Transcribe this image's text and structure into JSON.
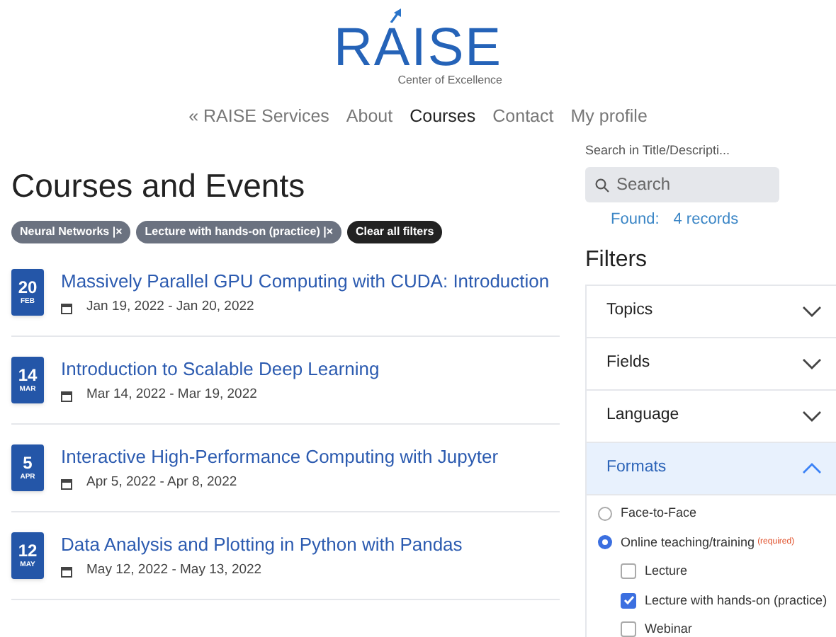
{
  "logo": {
    "name": "RAISE",
    "tagline": "Center of Excellence"
  },
  "nav": [
    {
      "label": "« RAISE Services",
      "selected": false
    },
    {
      "label": "About",
      "selected": false
    },
    {
      "label": "Courses",
      "selected": true
    },
    {
      "label": "Contact",
      "selected": false
    },
    {
      "label": "My profile",
      "selected": false
    }
  ],
  "heading": "Courses and Events",
  "active_filters": [
    {
      "label": "Neural Networks",
      "remove": "|×",
      "kind": "tag"
    },
    {
      "label": "Lecture with hands-on (practice)",
      "remove": "|×",
      "kind": "tag"
    },
    {
      "label": "Clear all filters",
      "kind": "clear"
    }
  ],
  "events": [
    {
      "day": "20",
      "month": "FEB",
      "title": "Massively Parallel GPU Computing with CUDA: Introduction",
      "dates": "Jan 19, 2022 - Jan 20, 2022"
    },
    {
      "day": "14",
      "month": "MAR",
      "title": "Introduction to Scalable Deep Learning",
      "dates": "Mar 14, 2022 - Mar 19, 2022"
    },
    {
      "day": "5",
      "month": "APR",
      "title": "Interactive High-Performance Computing with Jupyter",
      "dates": "Apr 5, 2022 - Apr 8, 2022"
    },
    {
      "day": "12",
      "month": "MAY",
      "title": "Data Analysis and Plotting in Python with Pandas",
      "dates": "May 12, 2022 - May 13, 2022"
    }
  ],
  "search": {
    "label": "Search in Title/Descripti...",
    "placeholder": "Search",
    "found_label": "Found:",
    "found_count": "4 records"
  },
  "filters": {
    "title": "Filters",
    "sections": [
      {
        "label": "Topics",
        "expanded": false
      },
      {
        "label": "Fields",
        "expanded": false
      },
      {
        "label": "Language",
        "expanded": false
      },
      {
        "label": "Formats",
        "expanded": true
      }
    ],
    "options": [
      {
        "label": "Face-to-Face",
        "kind": "radio",
        "selected": false
      },
      {
        "label": "Online teaching/training",
        "note": "(required)",
        "kind": "radio",
        "selected": true,
        "children": [
          {
            "label": "Lecture",
            "checked": false
          },
          {
            "label": "Lecture with hands-on (practice)",
            "checked": true
          },
          {
            "label": "Webinar",
            "checked": false
          }
        ]
      }
    ]
  }
}
